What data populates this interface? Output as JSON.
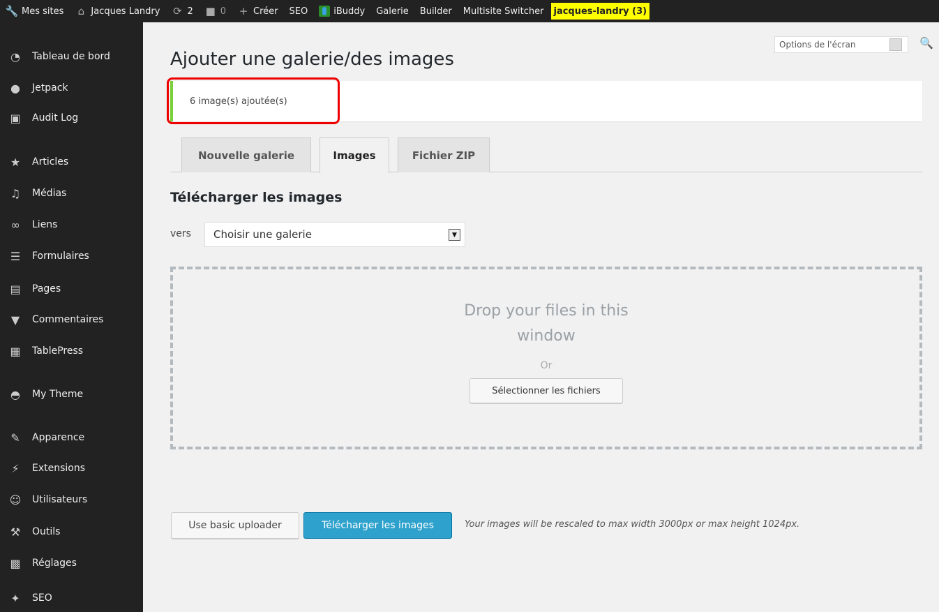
{
  "adminbar": {
    "items": [
      {
        "icon": "wrench-icon",
        "label": "Mes sites"
      },
      {
        "icon": "home-icon",
        "label": "Jacques Landry"
      },
      {
        "icon": "refresh-icon",
        "label": "2"
      },
      {
        "icon": "comment-icon",
        "label": "0"
      },
      {
        "icon": "plus-icon",
        "label": "Créer"
      },
      {
        "label": "SEO"
      },
      {
        "icon": "ibuddy-icon",
        "label": "iBuddy"
      },
      {
        "label": "Galerie"
      },
      {
        "label": "Builder"
      },
      {
        "label": "Multisite Switcher"
      },
      {
        "label": "jacques-landry (3)",
        "highlight_color": "#ffff00"
      }
    ]
  },
  "sidebar": {
    "items": [
      {
        "icon": "dashboard-icon",
        "label": "Tableau de bord"
      },
      {
        "icon": "jetpack-icon",
        "label": "Jetpack"
      },
      {
        "icon": "audit-log-icon",
        "label": "Audit Log"
      },
      {
        "icon": "pin-icon",
        "label": "Articles"
      },
      {
        "icon": "media-icon",
        "label": "Médias"
      },
      {
        "icon": "link-icon",
        "label": "Liens"
      },
      {
        "icon": "form-icon",
        "label": "Formulaires"
      },
      {
        "icon": "pages-icon",
        "label": "Pages"
      },
      {
        "icon": "comments-icon",
        "label": "Commentaires"
      },
      {
        "icon": "table-icon",
        "label": "TablePress"
      },
      {
        "icon": "theme-icon",
        "label": "My Theme"
      },
      {
        "icon": "brush-icon",
        "label": "Apparence"
      },
      {
        "icon": "plugin-icon",
        "label": "Extensions"
      },
      {
        "icon": "users-icon",
        "label": "Utilisateurs"
      },
      {
        "icon": "tools-icon",
        "label": "Outils"
      },
      {
        "icon": "settings-icon",
        "label": "Réglages"
      },
      {
        "icon": "seo-icon",
        "label": "SEO"
      }
    ]
  },
  "header": {
    "screen_options": "Options de l'écran",
    "page_title": "Ajouter une galerie/des images"
  },
  "notice": {
    "text": "6 image(s) ajoutée(s)",
    "accent_color": "#7ad03a",
    "highlight_color": "#e00000"
  },
  "tabs": [
    {
      "label": "Nouvelle galerie",
      "active": false
    },
    {
      "label": "Images",
      "active": true
    },
    {
      "label": "Fichier ZIP",
      "active": false
    }
  ],
  "upload": {
    "section_title": "Télécharger les images",
    "vers_label": "vers",
    "gallery_select_value": "Choisir une galerie",
    "drop_text_line1": "Drop your files in this",
    "drop_text_line2": "window",
    "or_text": "Or",
    "select_files_label": "Sélectionner les fichiers",
    "basic_uploader_label": "Use basic uploader",
    "upload_button_label": "Télécharger les images",
    "primary_color": "#2ea2cc",
    "rescale_note": "Your images will be rescaled to max width 3000px or max height 1024px."
  }
}
